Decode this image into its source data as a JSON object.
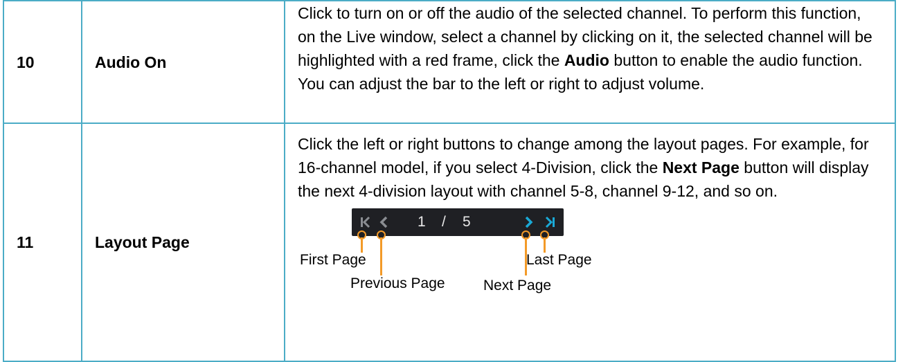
{
  "rows": [
    {
      "number": "10",
      "name": "Audio On",
      "desc": {
        "part1": "Click to turn on or off the audio of the selected channel. To perform this function, on the Live window, select a channel by clicking on it, the selected channel will be highlighted with a red frame, click the ",
        "bold1": "Audio",
        "part2": " button to enable the audio function. You can adjust the bar to the left or right to adjust volume."
      }
    },
    {
      "number": "11",
      "name": "Layout Page",
      "desc": {
        "part1": "Click the left or right buttons to change among the layout pages. For example, for 16-channel model, if you select 4-Division, click the ",
        "bold1": "Next Page",
        "part2": " button will display the next 4-division layout with channel 5-8, channel 9-12, and so on."
      },
      "pager": {
        "current": "1",
        "separator": "/",
        "total": "5",
        "icons": [
          "first-page-icon",
          "previous-page-icon",
          "next-page-icon",
          "last-page-icon"
        ],
        "colors": {
          "background": "#1f2024",
          "disabled": "#8a8d92",
          "active": "#1aa9d6",
          "callout": "#f39a28"
        },
        "labels": {
          "first": "First Page",
          "previous": "Previous Page",
          "next": "Next Page",
          "last": "Last Page"
        }
      }
    }
  ]
}
